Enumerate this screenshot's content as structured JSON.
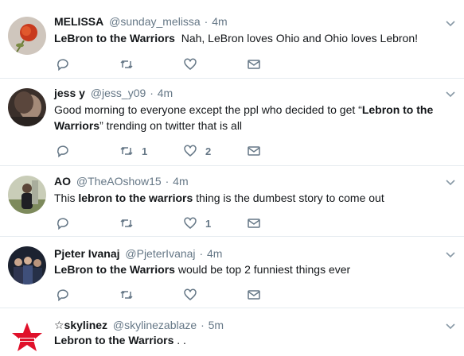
{
  "tweets": [
    {
      "name": "MELISSA",
      "handle": "@sunday_melissa",
      "time": "4m",
      "text_bold": "LeBron to the Warriors",
      "text_rest": "  Nah, LeBron loves Ohio and Ohio loves Lebron!",
      "reply_count": "",
      "retweet_count": "",
      "like_count": "",
      "avatar_icon": "rose-avatar"
    },
    {
      "name": "jess y",
      "handle": "@jess_y09",
      "time": "4m",
      "text_pre": "Good morning to everyone except the ppl who decided to get “",
      "text_bold": "Lebron to the Warriors",
      "text_post": "” trending on twitter that is all",
      "reply_count": "",
      "retweet_count": "1",
      "like_count": "2",
      "avatar_icon": "photo-avatar"
    },
    {
      "name": "AO",
      "handle": "@TheAOshow15",
      "time": "4m",
      "text_pre": "This ",
      "text_bold": "lebron to the warriors",
      "text_post": " thing is the dumbest story to come out",
      "reply_count": "",
      "retweet_count": "",
      "like_count": "1",
      "avatar_icon": "person-avatar"
    },
    {
      "name": "Pjeter Ivanaj",
      "handle": "@PjeterIvanaj",
      "time": "4m",
      "text_bold": "LeBron to the Warriors",
      "text_post": " would be top 2 funniest things ever",
      "reply_count": "",
      "retweet_count": "",
      "like_count": "",
      "avatar_icon": "group-avatar"
    },
    {
      "name": "☆skylinez",
      "handle": "@skylinezablaze",
      "time": "5m",
      "text_bold": "Lebron to the Warriors",
      "text_post": " . .",
      "avatar_icon": "star-logo-avatar"
    }
  ],
  "dot": "·",
  "colors": {
    "text": "#14171a",
    "muted": "#657786",
    "divider": "#e6ecf0"
  }
}
